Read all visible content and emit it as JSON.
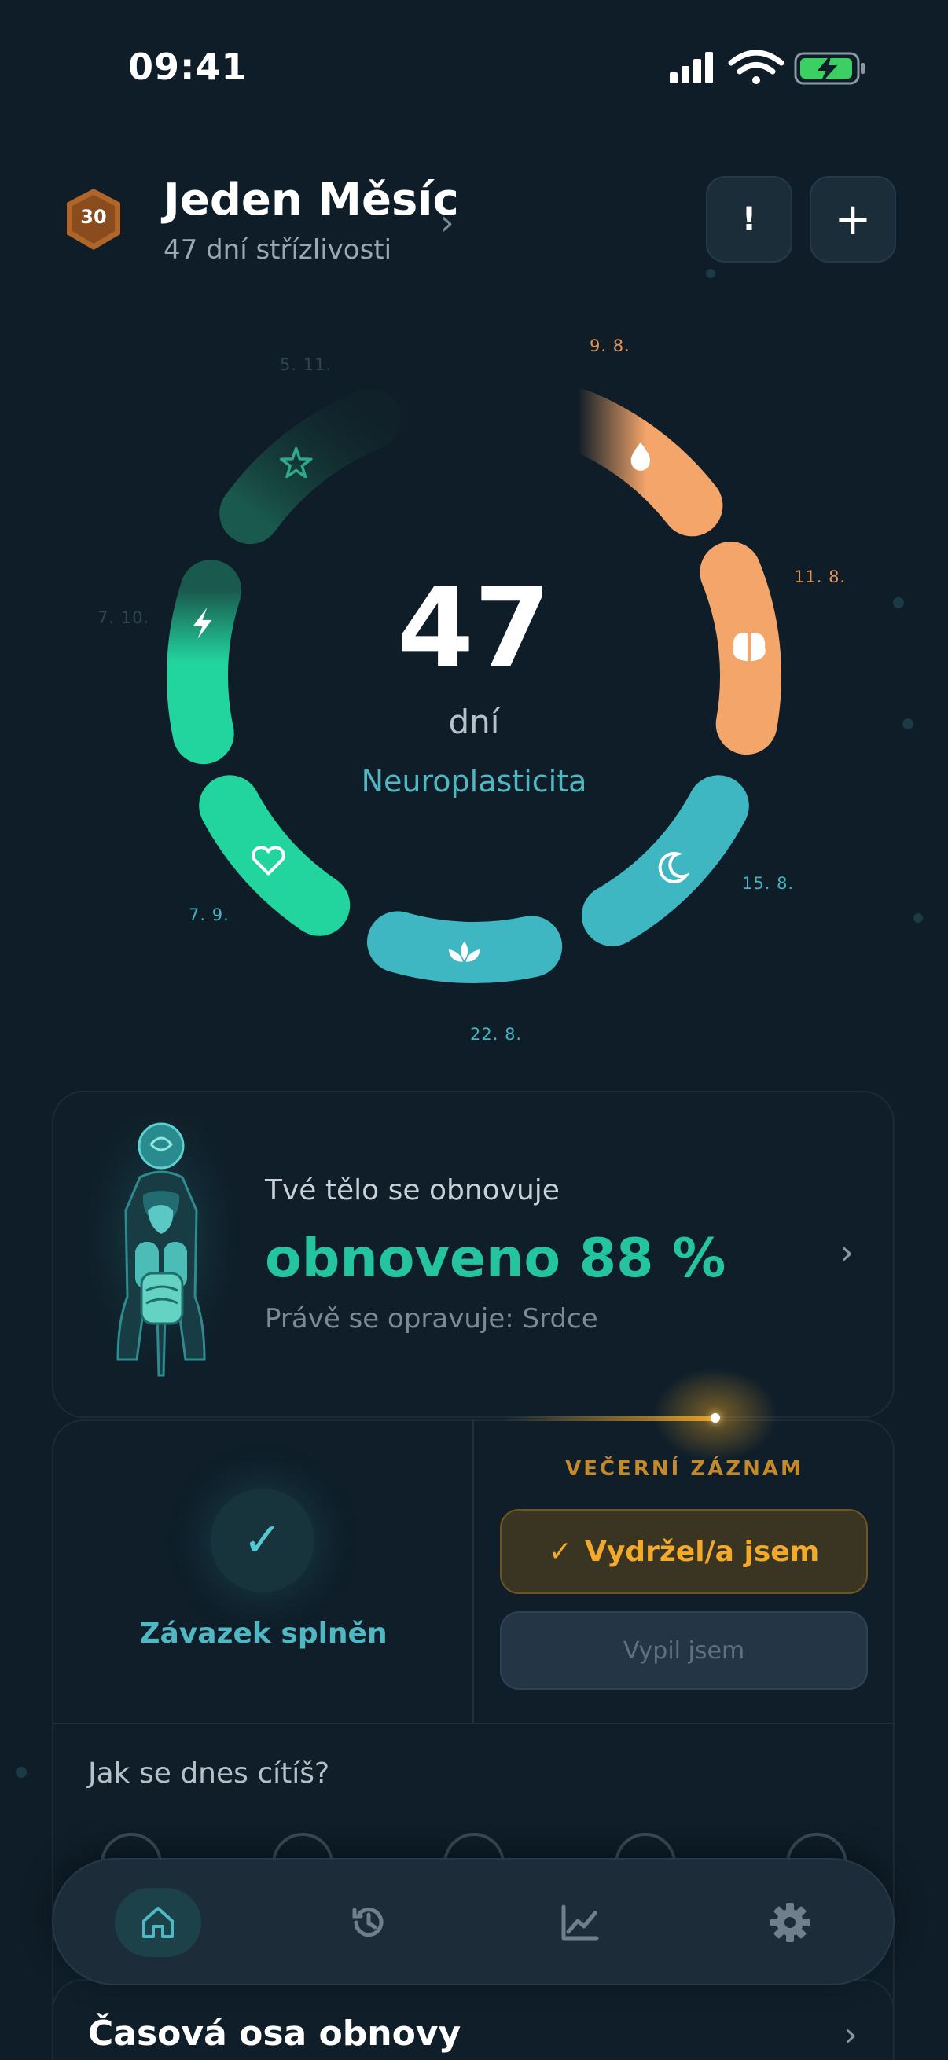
{
  "status": {
    "time": "09:41"
  },
  "header": {
    "badge_number": "30",
    "title": "Jeden Měsíc",
    "subtitle": "47 dní střízlivosti",
    "alert_label": "!",
    "add_label": "+"
  },
  "progress": {
    "days": "47",
    "unit": "dní",
    "phase": "Neuroplasticita",
    "milestones": [
      {
        "date": "9. 8.",
        "icon": "drop-icon",
        "color": "#f4a56a",
        "state": "done"
      },
      {
        "date": "11. 8.",
        "icon": "brain-icon",
        "color": "#f4a56a",
        "state": "done"
      },
      {
        "date": "15. 8.",
        "icon": "moon-icon",
        "color": "#3fb7c2",
        "state": "done"
      },
      {
        "date": "22. 8.",
        "icon": "lotus-icon",
        "color": "#3fb7c2",
        "state": "done"
      },
      {
        "date": "7. 9.",
        "icon": "heart-icon",
        "color": "#22d49e",
        "state": "done"
      },
      {
        "date": "7. 10.",
        "icon": "bolt-icon",
        "color": "#22d49e",
        "state": "in-progress"
      },
      {
        "date": "5. 11.",
        "icon": "star-icon",
        "color": "#1f6b5d",
        "state": "upcoming"
      }
    ]
  },
  "body_card": {
    "title": "Tvé tělo se obnovuje",
    "value": "obnoveno 88 %",
    "subtitle": "Právě se opravuje: Srdce"
  },
  "commitment": {
    "check": "✓",
    "label": "Závazek splněn"
  },
  "evening": {
    "label": "VEČERNÍ ZÁZNAM",
    "held_check": "✓",
    "held_button": "Vydržel/a jsem",
    "drank_button": "Vypil jsem"
  },
  "mood": {
    "question": "Jak se dnes cítíš?"
  },
  "tabbar": {
    "tabs": [
      {
        "icon": "home-icon",
        "active": true
      },
      {
        "icon": "history-icon",
        "active": false
      },
      {
        "icon": "chart-icon",
        "active": false
      },
      {
        "icon": "settings-icon",
        "active": false
      }
    ]
  },
  "timeline": {
    "title": "Časová osa obnovy"
  },
  "colors": {
    "background": "#0f1d28",
    "accent_teal": "#4fb8c3",
    "accent_green": "#25c4a0",
    "accent_orange": "#f3aa2a"
  }
}
